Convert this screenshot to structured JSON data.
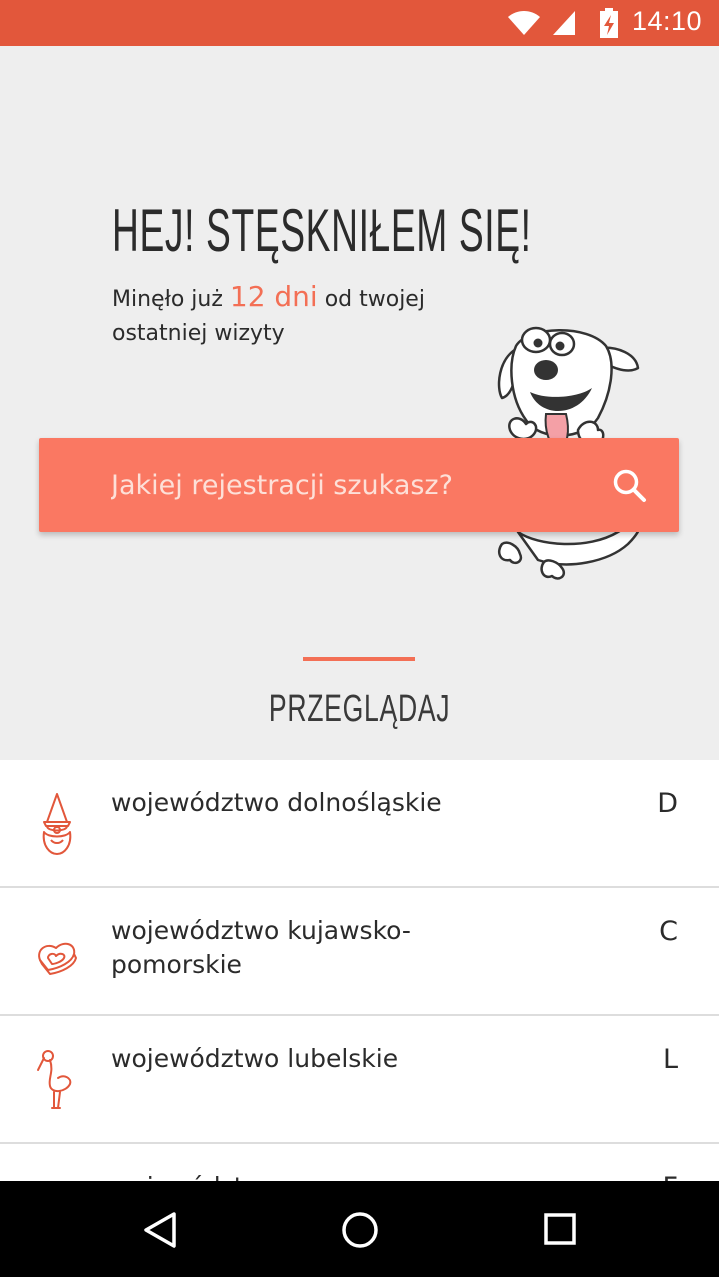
{
  "status_bar": {
    "time": "14:10",
    "icons": [
      "wifi-icon",
      "signal-icon",
      "battery-charging-icon"
    ]
  },
  "hero": {
    "headline": "HEJ! STĘSKNIŁEM SIĘ!",
    "subtitle_prefix": "Minęło już ",
    "days": "12 dni",
    "subtitle_suffix": " od twojej ostatniej wizyty"
  },
  "search": {
    "placeholder": "Jakiej rejestracji szukasz?",
    "value": ""
  },
  "browse": {
    "title": "PRZEGLĄDAJ"
  },
  "list": {
    "items": [
      {
        "name": "województwo dolnośląskie",
        "code": "D",
        "icon": "gnome-icon"
      },
      {
        "name": "województwo kujawsko-pomorskie",
        "code": "C",
        "icon": "gingerbread-heart-icon"
      },
      {
        "name": "województwo lubelskie",
        "code": "L",
        "icon": "stork-icon"
      },
      {
        "name": "województwo",
        "code": "F",
        "icon": "partial-icon"
      }
    ]
  },
  "colors": {
    "status_bar": "#e2573b",
    "accent": "#f36f55",
    "search_bar": "#fa7862"
  },
  "nav": {
    "icons": [
      "back-icon",
      "home-icon",
      "recent-apps-icon"
    ]
  }
}
